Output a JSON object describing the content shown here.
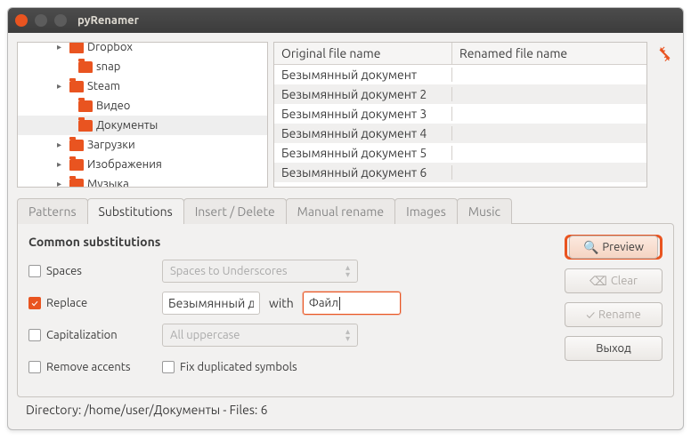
{
  "window": {
    "title": "pyRenamer"
  },
  "tree": {
    "items": [
      {
        "label": "Dropbox",
        "expander": "▸",
        "indent": 44
      },
      {
        "label": "snap",
        "expander": "",
        "indent": 54
      },
      {
        "label": "Steam",
        "expander": "▸",
        "indent": 44
      },
      {
        "label": "Видео",
        "expander": "",
        "indent": 54
      },
      {
        "label": "Документы",
        "expander": "",
        "indent": 54,
        "selected": true
      },
      {
        "label": "Загрузки",
        "expander": "▸",
        "indent": 44
      },
      {
        "label": "Изображения",
        "expander": "▸",
        "indent": 44
      },
      {
        "label": "Музыка",
        "expander": "▸",
        "indent": 44
      }
    ]
  },
  "filelist": {
    "col_original": "Original file name",
    "col_renamed": "Renamed file name",
    "rows": [
      {
        "orig": "Безымянный документ",
        "ren": ""
      },
      {
        "orig": "Безымянный документ 2",
        "ren": ""
      },
      {
        "orig": "Безымянный документ 3",
        "ren": ""
      },
      {
        "orig": "Безымянный документ 4",
        "ren": ""
      },
      {
        "orig": "Безымянный документ 5",
        "ren": ""
      },
      {
        "orig": "Безымянный документ 6",
        "ren": ""
      }
    ]
  },
  "tabs": {
    "patterns": "Patterns",
    "substitutions": "Substitutions",
    "insert_delete": "Insert / Delete",
    "manual_rename": "Manual rename",
    "images": "Images",
    "music": "Music"
  },
  "panel": {
    "title": "Common substitutions",
    "spaces_label": "Spaces",
    "spaces_combo": "Spaces to Underscores",
    "replace_label": "Replace",
    "replace_from": "Безымянный документ",
    "replace_with_label": "with",
    "replace_to": "Файл",
    "capitalization_label": "Capitalization",
    "capitalization_combo": "All uppercase",
    "remove_accents_label": "Remove accents",
    "fix_duplicated_label": "Fix duplicated symbols"
  },
  "buttons": {
    "preview": "Preview",
    "clear": "Clear",
    "rename": "Rename",
    "exit": "Выход"
  },
  "statusbar": "Directory: /home/user/Документы - Files: 6"
}
